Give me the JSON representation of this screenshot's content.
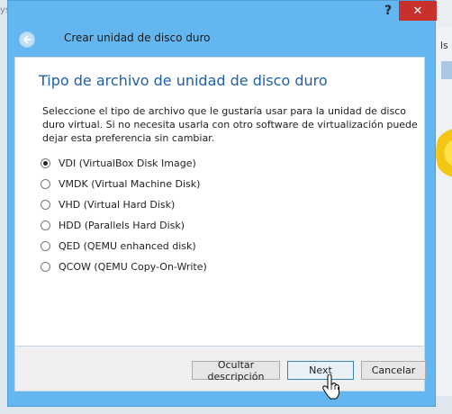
{
  "background": {
    "left_text": "ys",
    "right_text": "ls"
  },
  "dialog": {
    "help_label": "?",
    "close_label": "✕",
    "wizard_title": "Crear unidad de disco duro",
    "page_title": "Tipo de archivo de unidad de disco duro",
    "description": "Seleccione el tipo de archivo que le gustaría usar para la unidad de disco duro virtual. Si no necesita usarla con otro software de virtualización puede dejar esta preferencia sin cambiar.",
    "options": [
      {
        "label": "VDI (VirtualBox Disk Image)",
        "checked": true
      },
      {
        "label": "VMDK (Virtual Machine Disk)",
        "checked": false
      },
      {
        "label": "VHD (Virtual Hard Disk)",
        "checked": false
      },
      {
        "label": "HDD (Parallels Hard Disk)",
        "checked": false
      },
      {
        "label": "QED (QEMU enhanced disk)",
        "checked": false
      },
      {
        "label": "QCOW (QEMU Copy-On-Write)",
        "checked": false
      }
    ],
    "buttons": {
      "hide_description": "Ocultar descripción",
      "next": "Next",
      "cancel": "Cancelar"
    }
  },
  "colors": {
    "titlebar": "#63b6ef",
    "accent_title": "#1f5fa8",
    "close": "#c9302c"
  }
}
